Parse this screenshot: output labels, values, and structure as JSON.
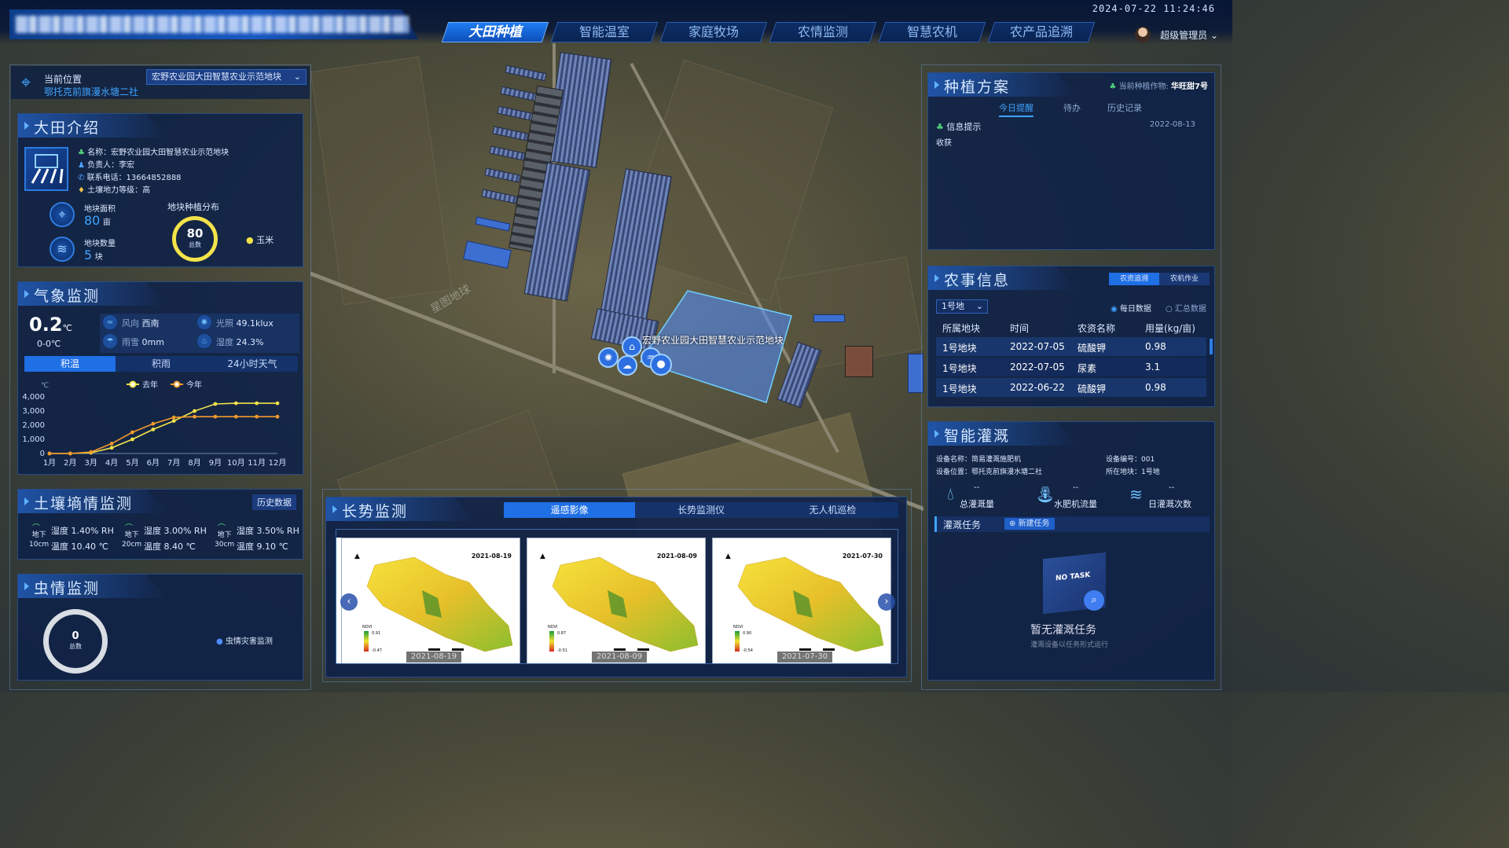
{
  "header": {
    "datetime": "2024-07-22 11:24:46",
    "user": "超级管理员",
    "nav": [
      {
        "label": "大田种植",
        "active": true
      },
      {
        "label": "智能温室",
        "active": false
      },
      {
        "label": "家庭牧场",
        "active": false
      },
      {
        "label": "农情监测",
        "active": false
      },
      {
        "label": "智慧农机",
        "active": false
      },
      {
        "label": "农产品追溯",
        "active": false
      }
    ]
  },
  "location": {
    "label": "当前位置",
    "address": "鄂托克前旗漫水塘二社",
    "selected": "宏野农业园大田智慧农业示范地块"
  },
  "field_intro": {
    "title": "大田介绍",
    "name": "名称：宏野农业园大田智慧农业示范地块",
    "manager": "负责人：李宏",
    "phone": "联系电话：13664852888",
    "soil": "土壤地力等级：高",
    "area_label": "地块面积",
    "area_value": "80",
    "area_unit": "亩",
    "count_label": "地块数量",
    "count_value": "5",
    "count_unit": "块",
    "dist_title": "地块种植分布",
    "dist_total": "80",
    "dist_total_label": "总数",
    "dist_legend": "玉米"
  },
  "weather": {
    "title": "气象监测",
    "temp": "0.2",
    "temp_unit": "℃",
    "temp_range": "0-0℃",
    "wind_label": "风向",
    "wind_value": "西南",
    "light_label": "光照",
    "light_value": "49.1klux",
    "rain_label": "雨雪",
    "rain_value": "0mm",
    "humidity_label": "湿度",
    "humidity_value": "24.3%",
    "tabs": [
      "积温",
      "积雨",
      "24小时天气"
    ],
    "legend_last": "去年",
    "legend_this": "今年",
    "y_unit": "℃"
  },
  "soil": {
    "title": "土壤墒情监测",
    "history": "历史数据",
    "depths": [
      {
        "depth1": "地下",
        "depth2": "10cm",
        "humidity": "湿度 1.40% RH",
        "temp": "温度 10.40 ℃"
      },
      {
        "depth1": "地下",
        "depth2": "20cm",
        "humidity": "湿度 3.00% RH",
        "temp": "温度 8.40 ℃"
      },
      {
        "depth1": "地下",
        "depth2": "30cm",
        "humidity": "湿度 3.50% RH",
        "temp": "温度 9.10 ℃"
      }
    ]
  },
  "pest": {
    "title": "虫情监测",
    "total": "0",
    "total_label": "总数",
    "legend": "虫情灾害监测"
  },
  "growth": {
    "title": "长势监测",
    "tabs": [
      "遥感影像",
      "长势监测仪",
      "无人机巡检"
    ],
    "images": [
      {
        "date": "2021-08-19",
        "caption": "2021-08-19",
        "max": "0.91",
        "min": "-0.47"
      },
      {
        "date": "2021-08-09",
        "caption": "2021-08-09",
        "max": "0.87",
        "min": "-0.51"
      },
      {
        "date": "2021-07-30",
        "caption": "2021-07-30",
        "max": "0.90",
        "min": "-0.54"
      }
    ]
  },
  "map": {
    "field_label": "宏野农业园大田智慧农业示范地块",
    "watermark": "星图地球"
  },
  "plan": {
    "title": "种植方案",
    "crop": "当前种植作物:",
    "crop_value": "华旺甜7号",
    "tabs": [
      "今日提醒",
      "待办",
      "历史记录"
    ],
    "info_title": "信息提示",
    "info_date": "2022-08-13",
    "info_text": "收获"
  },
  "farm": {
    "title": "农事信息",
    "tab_on": "农资追溯",
    "tab_off": "农机作业",
    "select": "1号地",
    "radio1": "每日数据",
    "radio2": "汇总数据",
    "headers": [
      "所属地块",
      "时间",
      "农资名称",
      "用量(kg/亩)"
    ],
    "rows": [
      [
        "1号地块",
        "2022-07-05",
        "硫酸钾",
        "0.98"
      ],
      [
        "1号地块",
        "2022-07-05",
        "尿素",
        "3.1"
      ],
      [
        "1号地块",
        "2022-06-22",
        "硫酸钾",
        "0.98"
      ]
    ]
  },
  "irrigation": {
    "title": "智能灌溉",
    "device_name": "设备名称：简易灌溉施肥机",
    "device_no": "设备编号：001",
    "device_loc": "设备位置：鄂托克前旗漫水塘二社",
    "device_plot": "所在地块：1号地",
    "stat1_val": "--",
    "stat1": "总灌溉量",
    "stat2_val": "--",
    "stat2": "水肥机流量",
    "stat3_val": "--",
    "stat3": "日灌溉次数",
    "task_title": "灌溉任务",
    "new_task": "新建任务",
    "no_task_badge": "NO TASK",
    "empty": "暂无灌溉任务",
    "empty_sub": "灌溉设备以任务形式运行"
  },
  "chart_data": {
    "type": "line",
    "categories": [
      "1月",
      "2月",
      "3月",
      "4月",
      "5月",
      "6月",
      "7月",
      "8月",
      "9月",
      "10月",
      "11月",
      "12月"
    ],
    "series": [
      {
        "name": "去年",
        "color": "#f2e34a",
        "values": [
          0,
          0,
          50,
          400,
          1000,
          1700,
          2300,
          3000,
          3500,
          3550,
          3550,
          3550
        ]
      },
      {
        "name": "今年",
        "color": "#f29a2c",
        "values": [
          0,
          0,
          100,
          700,
          1500,
          2100,
          2550,
          2600,
          2600,
          2600,
          2600,
          2600
        ]
      }
    ],
    "ylim": [
      0,
      4000
    ],
    "yticks": [
      0,
      1000,
      2000,
      3000,
      4000
    ],
    "ytick_labels": [
      "0",
      "1,000",
      "2,000",
      "3,000",
      "4,000"
    ],
    "ylabel": "℃",
    "grid": false,
    "legend": "top"
  }
}
